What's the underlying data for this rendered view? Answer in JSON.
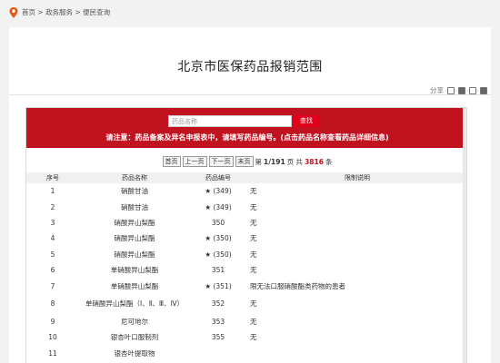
{
  "breadcrumb": {
    "home": "首页",
    "sep1": " > ",
    "mid": "政务服务",
    "sep2": " > ",
    "current": "便民查询"
  },
  "page_title": "北京市医保药品报销范围",
  "share": {
    "label": "分享"
  },
  "search": {
    "placeholder": "药品名称",
    "button": "查找"
  },
  "notice": "请注意：药品备案及异名申报表中，请填写药品编号。(点击药品名称查看药品详细信息)",
  "pager": {
    "first": "首页",
    "prev": "上一页",
    "next": "下一页",
    "last": "末页",
    "page_prefix": "第",
    "page": "1/191",
    "page_suffix": "页 共",
    "count": "3816",
    "count_suffix": "条"
  },
  "table": {
    "headers": [
      "序号",
      "药品名称",
      "药品编号",
      "限制说明"
    ],
    "rows": [
      {
        "no": "1",
        "name": "硝酸甘油",
        "star": "★",
        "code": "(349)",
        "desc": "无"
      },
      {
        "no": "2",
        "name": "硝酸甘油",
        "star": "★",
        "code": "(349)",
        "desc": "无"
      },
      {
        "no": "3",
        "name": "硝酸异山梨酯",
        "star": "",
        "code": "350",
        "desc": "无"
      },
      {
        "no": "4",
        "name": "硝酸异山梨酯",
        "star": "★",
        "code": "(350)",
        "desc": "无"
      },
      {
        "no": "5",
        "name": "硝酸异山梨酯",
        "star": "★",
        "code": "(350)",
        "desc": "无"
      },
      {
        "no": "6",
        "name": "单硝酸异山梨酯",
        "star": "",
        "code": "351",
        "desc": "无"
      },
      {
        "no": "7",
        "name": "单硝酸异山梨酯",
        "star": "★",
        "code": "(351)",
        "desc": "限无法口服硝酸酯类药物的患者"
      },
      {
        "no": "8",
        "name": "单硝酸异山梨酯（Ⅰ、Ⅱ、Ⅲ、Ⅳ）",
        "star": "",
        "code": "352",
        "desc": "无"
      },
      {
        "no": "9",
        "name": "尼可地尔",
        "star": "",
        "code": "353",
        "desc": "无"
      },
      {
        "no": "10",
        "name": "银杏叶口服制剂",
        "star": "",
        "code": "355",
        "desc": "无"
      },
      {
        "no": "11",
        "name": "银杏叶提取物",
        "star": "",
        "code": "",
        "desc": ""
      }
    ]
  },
  "colors": {
    "brand_red": "#c1121f",
    "search_button": "#e0001b"
  }
}
